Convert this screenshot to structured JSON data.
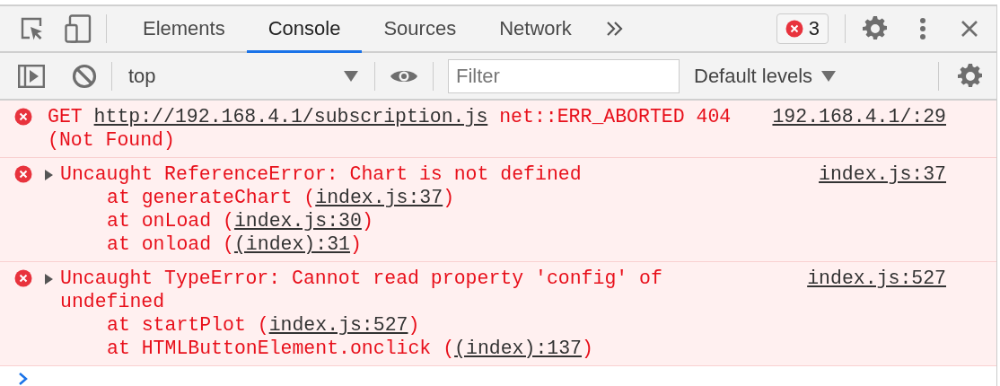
{
  "tabs": [
    {
      "label": "Elements",
      "selected": false
    },
    {
      "label": "Console",
      "selected": true
    },
    {
      "label": "Sources",
      "selected": false
    },
    {
      "label": "Network",
      "selected": false
    }
  ],
  "error_count": "3",
  "console_toolbar": {
    "context": "top",
    "filter": {
      "placeholder": "Filter"
    },
    "levels": "Default levels"
  },
  "messages": [
    {
      "expandable": false,
      "source": "192.168.4.1/:29",
      "lines": [
        {
          "indent": false,
          "parts": [
            {
              "text": "GET "
            },
            {
              "text": "http://192.168.4.1/subscription.js",
              "link": true
            },
            {
              "text": " net::ERR_ABORTED 404"
            }
          ]
        },
        {
          "indent": false,
          "parts": [
            {
              "text": "(Not Found)"
            }
          ]
        }
      ]
    },
    {
      "expandable": true,
      "source": "index.js:37",
      "lines": [
        {
          "indent": false,
          "parts": [
            {
              "text": "Uncaught ReferenceError: Chart is not defined"
            }
          ]
        },
        {
          "indent": true,
          "parts": [
            {
              "text": "at generateChart ("
            },
            {
              "text": "index.js:37",
              "link": true
            },
            {
              "text": ")"
            }
          ]
        },
        {
          "indent": true,
          "parts": [
            {
              "text": "at onLoad ("
            },
            {
              "text": "index.js:30",
              "link": true
            },
            {
              "text": ")"
            }
          ]
        },
        {
          "indent": true,
          "parts": [
            {
              "text": "at onload ("
            },
            {
              "text": "(index):31",
              "link": true
            },
            {
              "text": ")"
            }
          ]
        }
      ]
    },
    {
      "expandable": true,
      "source": "index.js:527",
      "lines": [
        {
          "indent": false,
          "parts": [
            {
              "text": "Uncaught TypeError: Cannot read property 'config' of"
            }
          ]
        },
        {
          "indent": false,
          "parts": [
            {
              "text": "undefined"
            }
          ]
        },
        {
          "indent": true,
          "parts": [
            {
              "text": "at startPlot ("
            },
            {
              "text": "index.js:527",
              "link": true
            },
            {
              "text": ")"
            }
          ]
        },
        {
          "indent": true,
          "parts": [
            {
              "text": "at HTMLButtonElement.onclick ("
            },
            {
              "text": "(index):137",
              "link": true
            },
            {
              "text": ")"
            }
          ]
        }
      ]
    }
  ]
}
